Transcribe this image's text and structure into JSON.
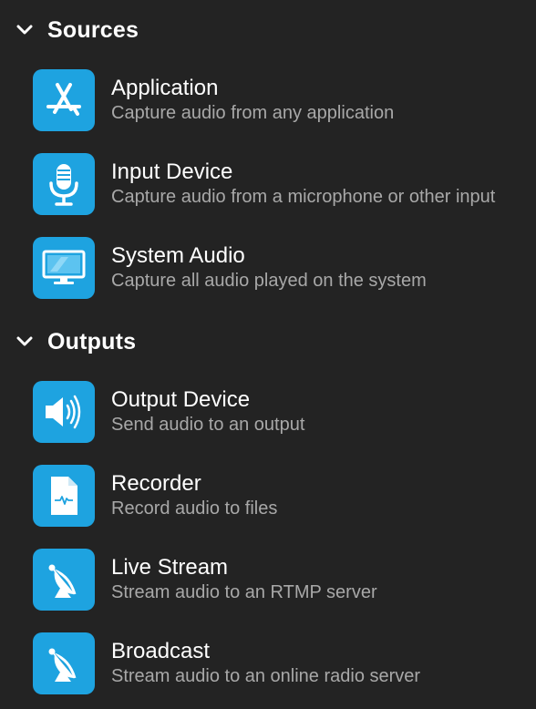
{
  "sections": {
    "sources": {
      "title": "Sources",
      "items": [
        {
          "name": "Application",
          "description": "Capture audio from any application",
          "icon": "app-store-icon"
        },
        {
          "name": "Input Device",
          "description": "Capture audio from a microphone or other input",
          "icon": "microphone-icon"
        },
        {
          "name": "System Audio",
          "description": "Capture all audio played on the system",
          "icon": "monitor-icon"
        }
      ]
    },
    "outputs": {
      "title": "Outputs",
      "items": [
        {
          "name": "Output Device",
          "description": "Send audio to an output",
          "icon": "speaker-icon"
        },
        {
          "name": "Recorder",
          "description": "Record audio to files",
          "icon": "audio-file-icon"
        },
        {
          "name": "Live Stream",
          "description": "Stream audio to an RTMP server",
          "icon": "satellite-dish-icon"
        },
        {
          "name": "Broadcast",
          "description": "Stream audio to an online radio server",
          "icon": "satellite-dish-icon"
        }
      ]
    }
  },
  "colors": {
    "background": "#232323",
    "icon_tile": "#1ea3e0",
    "title_text": "#ffffff",
    "description_text": "#a8a8a8"
  }
}
